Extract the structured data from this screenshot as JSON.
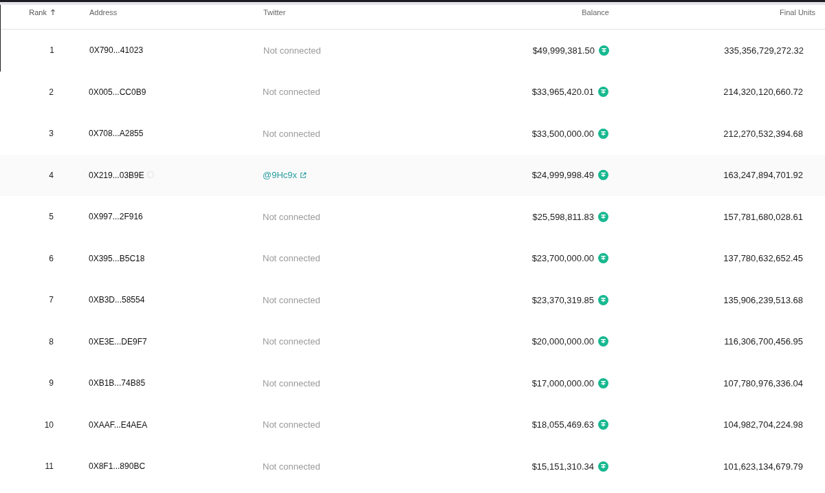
{
  "table": {
    "columns": [
      {
        "label": "Rank",
        "sorted": true
      },
      {
        "label": "Address",
        "sorted": false
      },
      {
        "label": "Twitter",
        "sorted": false
      },
      {
        "label": "Balance",
        "sorted": false
      },
      {
        "label": "Final Units",
        "sorted": false
      }
    ],
    "rows": [
      {
        "rank": "1",
        "address": "0X790...41023",
        "twitter": {
          "kind": "text",
          "label": "Not connected"
        },
        "balance": "$49,999,381.50",
        "final_units": "335,356,729,272.32",
        "hovered": false
      },
      {
        "rank": "2",
        "address": "0X005...CC0B9",
        "twitter": {
          "kind": "text",
          "label": "Not connected"
        },
        "balance": "$33,965,420.01",
        "final_units": "214,320,120,660.72",
        "hovered": false
      },
      {
        "rank": "3",
        "address": "0X708...A2855",
        "twitter": {
          "kind": "text",
          "label": "Not connected"
        },
        "balance": "$33,500,000.00",
        "final_units": "212,270,532,394.68",
        "hovered": false
      },
      {
        "rank": "4",
        "address": "0X219...03B9E",
        "twitter": {
          "kind": "link",
          "label": "@9Hc9x"
        },
        "balance": "$24,999,998.49",
        "final_units": "163,247,894,701.92",
        "hovered": true
      },
      {
        "rank": "5",
        "address": "0X997...2F916",
        "twitter": {
          "kind": "text",
          "label": "Not connected"
        },
        "balance": "$25,598,811.83",
        "final_units": "157,781,680,028.61",
        "hovered": false
      },
      {
        "rank": "6",
        "address": "0X395...B5C18",
        "twitter": {
          "kind": "text",
          "label": "Not connected"
        },
        "balance": "$23,700,000.00",
        "final_units": "137,780,632,652.45",
        "hovered": false
      },
      {
        "rank": "7",
        "address": "0XB3D...58554",
        "twitter": {
          "kind": "text",
          "label": "Not connected"
        },
        "balance": "$23,370,319.85",
        "final_units": "135,906,239,513.68",
        "hovered": false
      },
      {
        "rank": "8",
        "address": "0XE3E...DE9F7",
        "twitter": {
          "kind": "text",
          "label": "Not connected"
        },
        "balance": "$20,000,000.00",
        "final_units": "116,306,700,456.95",
        "hovered": false
      },
      {
        "rank": "9",
        "address": "0XB1B...74B85",
        "twitter": {
          "kind": "text",
          "label": "Not connected"
        },
        "balance": "$17,000,000.00",
        "final_units": "107,780,976,336.04",
        "hovered": false
      },
      {
        "rank": "10",
        "address": "0XAAF...E4AEA",
        "twitter": {
          "kind": "text",
          "label": "Not connected"
        },
        "balance": "$18,055,469.63",
        "final_units": "104,982,704,224.98",
        "hovered": false
      },
      {
        "rank": "11",
        "address": "0X8F1...890BC",
        "twitter": {
          "kind": "text",
          "label": "Not connected"
        },
        "balance": "$15,151,310.34",
        "final_units": "101,623,134,679.79",
        "hovered": false
      }
    ]
  }
}
